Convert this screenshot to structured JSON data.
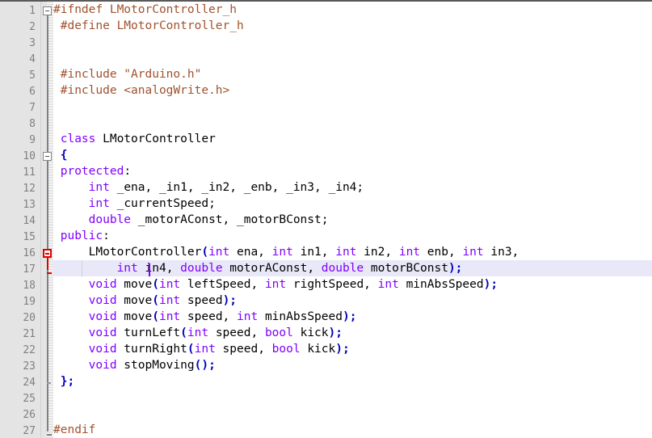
{
  "editor": {
    "name": "code-editor",
    "language": "C++ Header",
    "line_count": 27,
    "current_line": 17,
    "caret": {
      "line": 17,
      "column": 13
    },
    "colors": {
      "background": "#ffffff",
      "gutter_background": "#e4e4e4",
      "line_number": "#808080",
      "current_line_highlight": "#e8e8f8",
      "preprocessor": "#a0522d",
      "keyword": "#8000ff",
      "identifier": "#000000",
      "punctuation": "#0000c0",
      "fold_marker": "#808080",
      "fold_marker_active": "#e00000",
      "caret": "#8000ff"
    },
    "line_numbers": [
      1,
      2,
      3,
      4,
      5,
      6,
      7,
      8,
      9,
      10,
      11,
      12,
      13,
      14,
      15,
      16,
      17,
      18,
      19,
      20,
      21,
      22,
      23,
      24,
      25,
      26,
      27
    ],
    "lines": [
      {
        "n": 1,
        "fold": "box-open",
        "tokens": [
          {
            "t": "pre",
            "v": "#ifndef LMotorController_h"
          }
        ]
      },
      {
        "n": 2,
        "fold": "bar",
        "tokens": [
          {
            "t": "pre",
            "v": " #define LMotorController_h"
          }
        ]
      },
      {
        "n": 3,
        "fold": "bar",
        "tokens": []
      },
      {
        "n": 4,
        "fold": "bar",
        "tokens": []
      },
      {
        "n": 5,
        "fold": "bar",
        "tokens": [
          {
            "t": "pre",
            "v": " #include \"Arduino.h\""
          }
        ]
      },
      {
        "n": 6,
        "fold": "bar",
        "tokens": [
          {
            "t": "pre",
            "v": " #include <analogWrite.h>"
          }
        ]
      },
      {
        "n": 7,
        "fold": "bar",
        "tokens": []
      },
      {
        "n": 8,
        "fold": "bar",
        "tokens": []
      },
      {
        "n": 9,
        "fold": "bar",
        "tokens": [
          {
            "t": "id",
            "v": " "
          },
          {
            "t": "kw",
            "v": "class"
          },
          {
            "t": "id",
            "v": " LMotorController"
          }
        ]
      },
      {
        "n": 10,
        "fold": "box-open",
        "tokens": [
          {
            "t": "id",
            "v": " "
          },
          {
            "t": "punc",
            "v": "{"
          }
        ]
      },
      {
        "n": 11,
        "fold": "bar",
        "tokens": [
          {
            "t": "id",
            "v": " "
          },
          {
            "t": "kw",
            "v": "protected"
          },
          {
            "t": "op",
            "v": ":"
          }
        ]
      },
      {
        "n": 12,
        "fold": "bar",
        "tokens": [
          {
            "t": "id",
            "v": "     "
          },
          {
            "t": "kw",
            "v": "int"
          },
          {
            "t": "id",
            "v": " _ena, _in1, _in2, _enb, _in3, _in4;"
          }
        ]
      },
      {
        "n": 13,
        "fold": "bar",
        "tokens": [
          {
            "t": "id",
            "v": "     "
          },
          {
            "t": "kw",
            "v": "int"
          },
          {
            "t": "id",
            "v": " _currentSpeed;"
          }
        ]
      },
      {
        "n": 14,
        "fold": "bar",
        "tokens": [
          {
            "t": "id",
            "v": "     "
          },
          {
            "t": "kw",
            "v": "double"
          },
          {
            "t": "id",
            "v": " _motorAConst, _motorBConst;"
          }
        ]
      },
      {
        "n": 15,
        "fold": "bar",
        "tokens": [
          {
            "t": "id",
            "v": " "
          },
          {
            "t": "kw",
            "v": "public"
          },
          {
            "t": "op",
            "v": ":"
          }
        ]
      },
      {
        "n": 16,
        "fold": "box-open-red",
        "tokens": [
          {
            "t": "id",
            "v": "     LMotorController"
          },
          {
            "t": "punc",
            "v": "("
          },
          {
            "t": "kw",
            "v": "int"
          },
          {
            "t": "id",
            "v": " ena, "
          },
          {
            "t": "kw",
            "v": "int"
          },
          {
            "t": "id",
            "v": " in1, "
          },
          {
            "t": "kw",
            "v": "int"
          },
          {
            "t": "id",
            "v": " in2, "
          },
          {
            "t": "kw",
            "v": "int"
          },
          {
            "t": "id",
            "v": " enb, "
          },
          {
            "t": "kw",
            "v": "int"
          },
          {
            "t": "id",
            "v": " in3,"
          }
        ]
      },
      {
        "n": 17,
        "fold": "elbow-red",
        "current": true,
        "tokens": [
          {
            "t": "id",
            "v": "         "
          },
          {
            "t": "kw",
            "v": "int"
          },
          {
            "t": "id",
            "v": " in4, "
          },
          {
            "t": "kw",
            "v": "double"
          },
          {
            "t": "id",
            "v": " motorAConst, "
          },
          {
            "t": "kw",
            "v": "double"
          },
          {
            "t": "id",
            "v": " motorBConst"
          },
          {
            "t": "punc",
            "v": ");"
          }
        ]
      },
      {
        "n": 18,
        "fold": "bar",
        "tokens": [
          {
            "t": "id",
            "v": "     "
          },
          {
            "t": "kw",
            "v": "void"
          },
          {
            "t": "id",
            "v": " move"
          },
          {
            "t": "punc",
            "v": "("
          },
          {
            "t": "kw",
            "v": "int"
          },
          {
            "t": "id",
            "v": " leftSpeed, "
          },
          {
            "t": "kw",
            "v": "int"
          },
          {
            "t": "id",
            "v": " rightSpeed, "
          },
          {
            "t": "kw",
            "v": "int"
          },
          {
            "t": "id",
            "v": " minAbsSpeed"
          },
          {
            "t": "punc",
            "v": ");"
          }
        ]
      },
      {
        "n": 19,
        "fold": "bar",
        "tokens": [
          {
            "t": "id",
            "v": "     "
          },
          {
            "t": "kw",
            "v": "void"
          },
          {
            "t": "id",
            "v": " move"
          },
          {
            "t": "punc",
            "v": "("
          },
          {
            "t": "kw",
            "v": "int"
          },
          {
            "t": "id",
            "v": " speed"
          },
          {
            "t": "punc",
            "v": ");"
          }
        ]
      },
      {
        "n": 20,
        "fold": "bar",
        "tokens": [
          {
            "t": "id",
            "v": "     "
          },
          {
            "t": "kw",
            "v": "void"
          },
          {
            "t": "id",
            "v": " move"
          },
          {
            "t": "punc",
            "v": "("
          },
          {
            "t": "kw",
            "v": "int"
          },
          {
            "t": "id",
            "v": " speed, "
          },
          {
            "t": "kw",
            "v": "int"
          },
          {
            "t": "id",
            "v": " minAbsSpeed"
          },
          {
            "t": "punc",
            "v": ");"
          }
        ]
      },
      {
        "n": 21,
        "fold": "bar",
        "tokens": [
          {
            "t": "id",
            "v": "     "
          },
          {
            "t": "kw",
            "v": "void"
          },
          {
            "t": "id",
            "v": " turnLeft"
          },
          {
            "t": "punc",
            "v": "("
          },
          {
            "t": "kw",
            "v": "int"
          },
          {
            "t": "id",
            "v": " speed, "
          },
          {
            "t": "kw",
            "v": "bool"
          },
          {
            "t": "id",
            "v": " kick"
          },
          {
            "t": "punc",
            "v": ");"
          }
        ]
      },
      {
        "n": 22,
        "fold": "bar",
        "tokens": [
          {
            "t": "id",
            "v": "     "
          },
          {
            "t": "kw",
            "v": "void"
          },
          {
            "t": "id",
            "v": " turnRight"
          },
          {
            "t": "punc",
            "v": "("
          },
          {
            "t": "kw",
            "v": "int"
          },
          {
            "t": "id",
            "v": " speed, "
          },
          {
            "t": "kw",
            "v": "bool"
          },
          {
            "t": "id",
            "v": " kick"
          },
          {
            "t": "punc",
            "v": ");"
          }
        ]
      },
      {
        "n": 23,
        "fold": "bar",
        "tokens": [
          {
            "t": "id",
            "v": "     "
          },
          {
            "t": "kw",
            "v": "void"
          },
          {
            "t": "id",
            "v": " stopMoving"
          },
          {
            "t": "punc",
            "v": "();"
          }
        ]
      },
      {
        "n": 24,
        "fold": "tick",
        "tokens": [
          {
            "t": "id",
            "v": " "
          },
          {
            "t": "punc",
            "v": "};"
          }
        ]
      },
      {
        "n": 25,
        "fold": "bar",
        "tokens": []
      },
      {
        "n": 26,
        "fold": "bar",
        "tokens": []
      },
      {
        "n": 27,
        "fold": "elbow",
        "tokens": [
          {
            "t": "pre",
            "v": "#endif"
          }
        ]
      }
    ]
  }
}
